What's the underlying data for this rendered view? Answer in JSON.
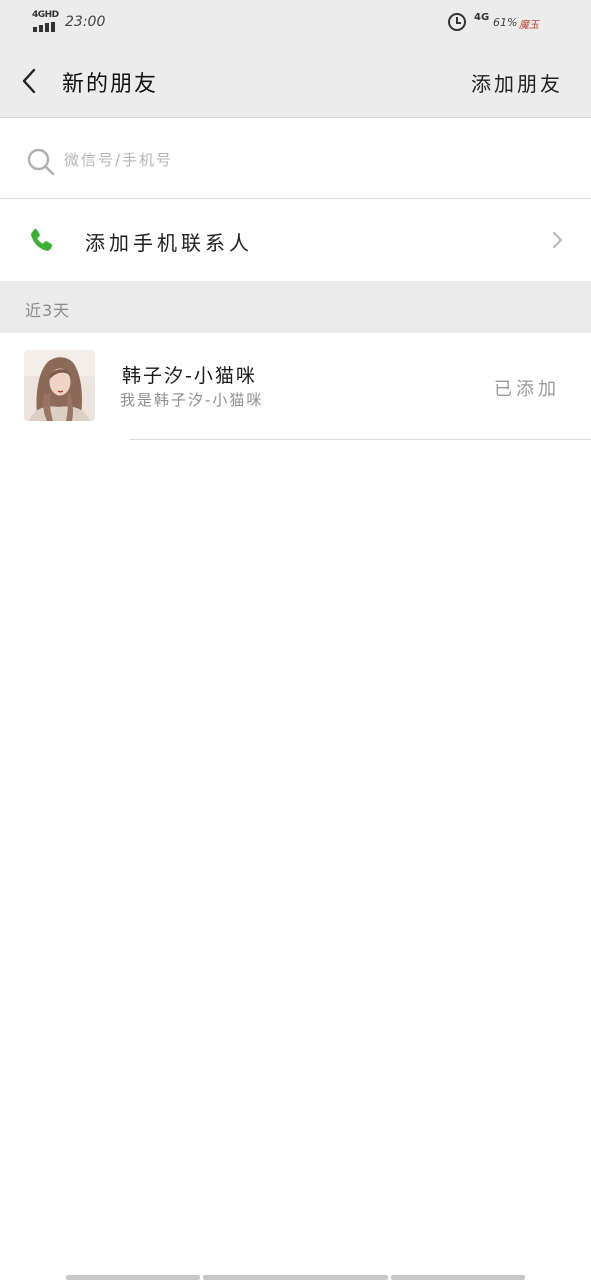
{
  "status_bar": {
    "network_label": "4GHD",
    "time": "23:00",
    "alarm_icon": "alarm-clock-icon",
    "network_type": "4G",
    "battery": "61%",
    "carrier_badge": "魔玉"
  },
  "header": {
    "back_icon": "chevron-left-icon",
    "title": "新的朋友",
    "action_label": "添加朋友"
  },
  "search": {
    "icon": "search-icon",
    "placeholder": "微信号/手机号",
    "value": ""
  },
  "phone_contacts": {
    "icon": "phone-icon",
    "label": "添加手机联系人",
    "chevron_icon": "chevron-right-icon",
    "icon_color": "#3cb034"
  },
  "sections": [
    {
      "label": "近3天",
      "items": [
        {
          "avatar": "avatar-image",
          "name": "韩子汐-小猫咪",
          "message": "我是韩子汐-小猫咪",
          "status": "已添加"
        }
      ]
    }
  ]
}
